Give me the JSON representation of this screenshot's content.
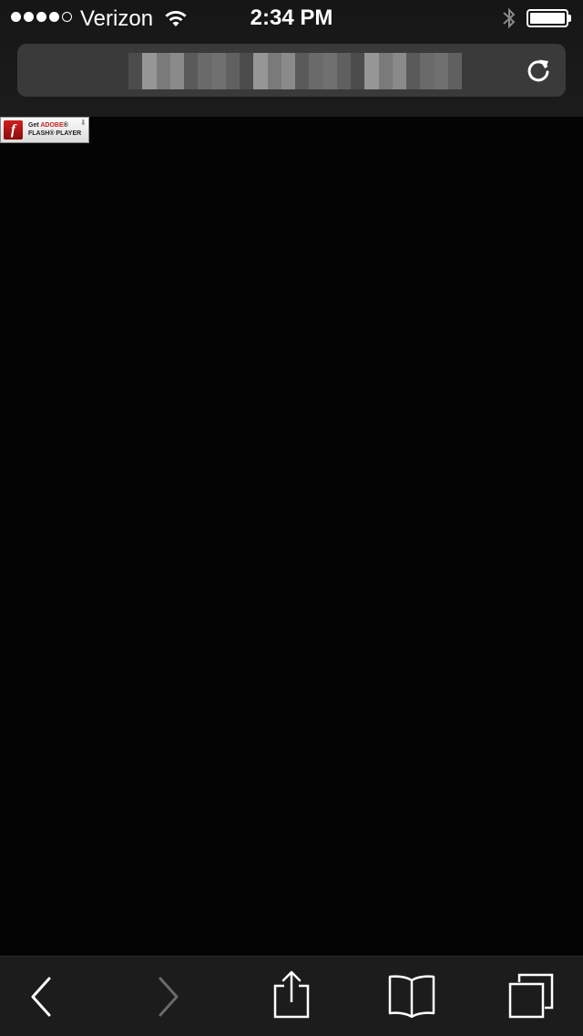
{
  "status_bar": {
    "signal_bars": 5,
    "signal_filled": 4,
    "carrier": "Verizon",
    "time": "2:34 PM",
    "wifi_icon": "wifi-icon",
    "bluetooth_icon": "bluetooth-icon",
    "battery_level": 1.0
  },
  "browser": {
    "url_redacted": true,
    "reload_icon": "reload-icon"
  },
  "plugin_badge": {
    "line1_prefix": "Get",
    "line1_brand": "ADOBE",
    "line1_suffix": "®",
    "line2": "FLASH® PLAYER",
    "logo_glyph": "f"
  },
  "toolbar": {
    "back_enabled": true,
    "forward_enabled": false,
    "icons": [
      "back-chevron-icon",
      "forward-chevron-icon",
      "share-icon",
      "bookmarks-icon",
      "tabs-icon"
    ]
  },
  "colors": {
    "page_background": "#050405",
    "chrome_background": "#1c1c1c",
    "url_bar": "#3a3a3a",
    "flash_red": "#d01f1f",
    "icon_white": "#ffffff",
    "icon_disabled": "#6a6a6a"
  }
}
